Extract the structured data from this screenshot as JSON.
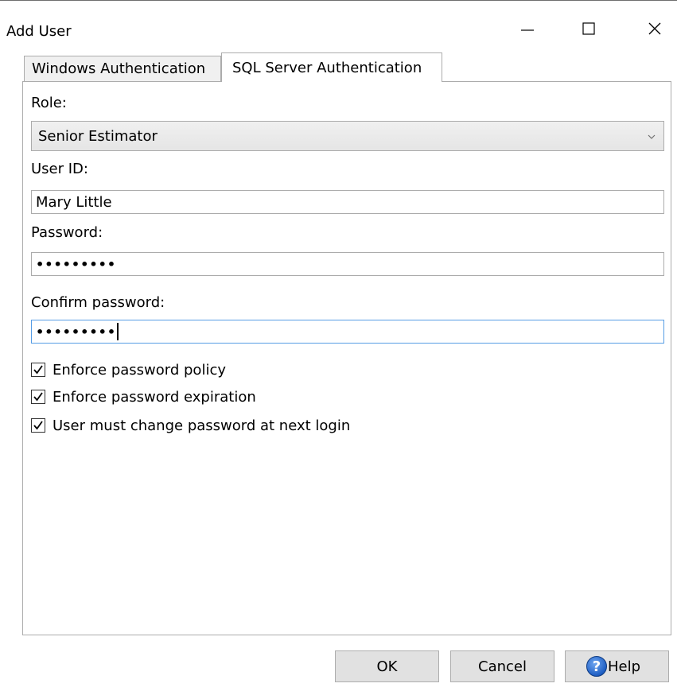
{
  "window": {
    "title": "Add User"
  },
  "tabs": [
    {
      "label": "Windows Authentication",
      "selected": false
    },
    {
      "label": "SQL Server Authentication",
      "selected": true
    }
  ],
  "form": {
    "role_label": "Role:",
    "role_value": "Senior Estimator",
    "user_id_label": "User ID:",
    "user_id_value": "Mary Little",
    "password_label": "Password:",
    "password_value": "•••••••••",
    "confirm_label": "Confirm password:",
    "confirm_value": "•••••••••"
  },
  "checkboxes": [
    {
      "label": "Enforce password policy",
      "checked": true
    },
    {
      "label": "Enforce password expiration",
      "checked": true
    },
    {
      "label": "User must change password at next login",
      "checked": true
    }
  ],
  "buttons": {
    "ok": "OK",
    "cancel": "Cancel",
    "help": "Help"
  },
  "icons": {
    "minimize": "minimize-icon",
    "maximize": "maximize-icon",
    "close": "close-icon",
    "dropdown": "chevron-down-icon",
    "check": "checkmark-icon",
    "help": "help-icon"
  },
  "colors": {
    "focus_border": "#569de5",
    "help_icon": "#1f5fc4"
  }
}
